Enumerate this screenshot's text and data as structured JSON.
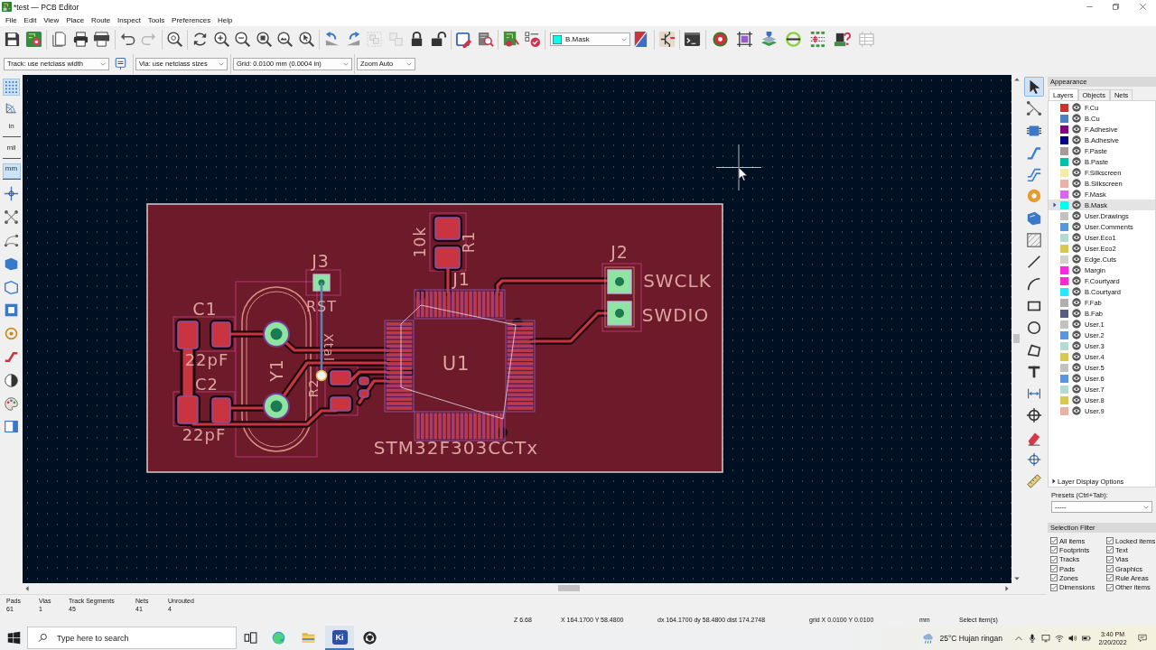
{
  "window": {
    "title": "*test — PCB Editor"
  },
  "menu": [
    "File",
    "Edit",
    "View",
    "Place",
    "Route",
    "Inspect",
    "Tools",
    "Preferences",
    "Help"
  ],
  "main_toolbar": [
    {
      "kind": "undo",
      "disabled": false
    },
    {
      "kind": "redo",
      "disabled": true
    },
    {
      "kind": "group",
      "disabled": true
    },
    {
      "kind": "ungroup",
      "disabled": true
    }
  ],
  "layer_selector": {
    "value": "B.Mask"
  },
  "options_bar": {
    "track": "Track: use netclass width",
    "via": "Via: use netclass sizes",
    "grid": "Grid: 0.0100 mm (0.0004 in)",
    "zoom": "Zoom Auto"
  },
  "view_toggles": [
    {
      "kind": "grid",
      "selected": true
    },
    {
      "kind": "polar",
      "selected": false
    }
  ],
  "units": [
    {
      "label": "in",
      "selected": false
    },
    {
      "label": "mil",
      "selected": false
    },
    {
      "label": "mm",
      "selected": true
    }
  ],
  "tools": [
    {
      "kind": "select",
      "selected": true
    },
    {
      "kind": "ratsnest",
      "selected": false
    },
    {
      "kind": "footprint",
      "selected": false
    },
    {
      "kind": "track",
      "selected": false
    },
    {
      "kind": "diffpair",
      "selected": false
    },
    {
      "kind": "via",
      "selected": false
    },
    {
      "kind": "zone",
      "selected": false
    },
    {
      "kind": "rulearea",
      "selected": false
    },
    {
      "kind": "line",
      "selected": false
    },
    {
      "kind": "arc",
      "selected": false
    },
    {
      "kind": "rectangle",
      "selected": false
    },
    {
      "kind": "circle",
      "selected": false
    },
    {
      "kind": "polygon",
      "selected": false
    },
    {
      "kind": "text",
      "selected": false
    },
    {
      "kind": "dimension",
      "selected": false
    },
    {
      "kind": "target",
      "selected": false
    },
    {
      "kind": "delete",
      "selected": false
    },
    {
      "kind": "origin",
      "selected": false
    },
    {
      "kind": "measure",
      "selected": false
    }
  ],
  "board": {
    "labels": [
      "10k",
      "R1",
      "J2",
      "J3",
      "J1",
      "SWCLK",
      "C1",
      "RST",
      "SWDIO",
      "Xtal",
      "22pF",
      "U1",
      "Y1",
      "C2",
      "R2",
      "22pF",
      "STM32F303CCTx"
    ]
  },
  "appearance": {
    "title": "Appearance",
    "tabs": [
      {
        "label": "Layers",
        "selected": true
      },
      {
        "label": "Objects",
        "selected": false
      },
      {
        "label": "Nets",
        "selected": false
      }
    ],
    "layers": [
      {
        "name": "F.Cu",
        "color": "#c83434",
        "visible": true,
        "selected": false
      },
      {
        "name": "B.Cu",
        "color": "#4d7fc4",
        "visible": true,
        "selected": false
      },
      {
        "name": "F.Adhesive",
        "color": "#84007c",
        "visible": true,
        "selected": false
      },
      {
        "name": "B.Adhesive",
        "color": "#000084",
        "visible": true,
        "selected": false
      },
      {
        "name": "F.Paste",
        "color": "#a89a9a",
        "visible": true,
        "selected": false
      },
      {
        "name": "B.Paste",
        "color": "#00c2a9",
        "visible": true,
        "selected": false
      },
      {
        "name": "F.Silkscreen",
        "color": "#f2eda1",
        "visible": true,
        "selected": false
      },
      {
        "name": "B.Silkscreen",
        "color": "#e8b2a7",
        "visible": true,
        "selected": false
      },
      {
        "name": "F.Mask",
        "color": "#d864ff",
        "visible": true,
        "selected": false
      },
      {
        "name": "B.Mask",
        "color": "#02ffee",
        "visible": true,
        "selected": true
      },
      {
        "name": "User.Drawings",
        "color": "#c2c2c2",
        "visible": true,
        "selected": false
      },
      {
        "name": "User.Comments",
        "color": "#5994dc",
        "visible": true,
        "selected": false
      },
      {
        "name": "User.Eco1",
        "color": "#b4dbd2",
        "visible": true,
        "selected": false
      },
      {
        "name": "User.Eco2",
        "color": "#d8c852",
        "visible": true,
        "selected": false
      },
      {
        "name": "Edge.Cuts",
        "color": "#d0d2cd",
        "visible": true,
        "selected": false
      },
      {
        "name": "Margin",
        "color": "#ff26e2",
        "visible": true,
        "selected": false
      },
      {
        "name": "F.Courtyard",
        "color": "#ff26e2",
        "visible": true,
        "selected": false
      },
      {
        "name": "B.Courtyard",
        "color": "#26e9ff",
        "visible": true,
        "selected": false
      },
      {
        "name": "F.Fab",
        "color": "#afafaf",
        "visible": true,
        "selected": false
      },
      {
        "name": "B.Fab",
        "color": "#585d84",
        "visible": true,
        "selected": false
      },
      {
        "name": "User.1",
        "color": "#c2c2c2",
        "visible": true,
        "selected": false
      },
      {
        "name": "User.2",
        "color": "#5994dc",
        "visible": true,
        "selected": false
      },
      {
        "name": "User.3",
        "color": "#b4dbd2",
        "visible": true,
        "selected": false
      },
      {
        "name": "User.4",
        "color": "#d8c852",
        "visible": true,
        "selected": false
      },
      {
        "name": "User.5",
        "color": "#c2c2c2",
        "visible": true,
        "selected": false
      },
      {
        "name": "User.6",
        "color": "#5994dc",
        "visible": true,
        "selected": false
      },
      {
        "name": "User.7",
        "color": "#b4dbd2",
        "visible": true,
        "selected": false
      },
      {
        "name": "User.8",
        "color": "#d8c852",
        "visible": true,
        "selected": false
      },
      {
        "name": "User.9",
        "color": "#e8b2a7",
        "visible": true,
        "selected": false
      }
    ],
    "display_options": {
      "label": "Layer Display Options",
      "expanded": false
    },
    "presets": {
      "label": "Presets (Ctrl+Tab):",
      "value": "-----"
    }
  },
  "selection_filter": {
    "title": "Selection Filter",
    "items": [
      {
        "label": "All items",
        "checked": true
      },
      {
        "label": "Locked items",
        "checked": true
      },
      {
        "label": "Footprints",
        "checked": true
      },
      {
        "label": "Text",
        "checked": true
      },
      {
        "label": "Tracks",
        "checked": true
      },
      {
        "label": "Vias",
        "checked": true
      },
      {
        "label": "Pads",
        "checked": true
      },
      {
        "label": "Graphics",
        "checked": true
      },
      {
        "label": "Zones",
        "checked": true
      },
      {
        "label": "Rule Areas",
        "checked": true
      },
      {
        "label": "Dimensions",
        "checked": true
      },
      {
        "label": "Other items",
        "checked": true
      }
    ]
  },
  "board_stats": [
    {
      "label": "Pads",
      "value": "61"
    },
    {
      "label": "Vias",
      "value": "1"
    },
    {
      "label": "Track Segments",
      "value": "45"
    },
    {
      "label": "Nets",
      "value": "41"
    },
    {
      "label": "Unrouted",
      "value": "4"
    }
  ],
  "status_bar": [
    "Z 6.68",
    "X 164.1700 Y 58.4800",
    "dx 164.1700 dy 58.4800 dist 174.2748",
    "grid X 0.0100 Y 0.0100",
    "mm",
    "Select item(s)"
  ],
  "taskbar": {
    "search": {
      "placeholder": "Type here to search"
    },
    "app_button": {
      "label": "Ki",
      "selected": true
    },
    "weather": "25°C Hujan ringan",
    "time": "3:40 PM",
    "date": "2/20/2022"
  }
}
